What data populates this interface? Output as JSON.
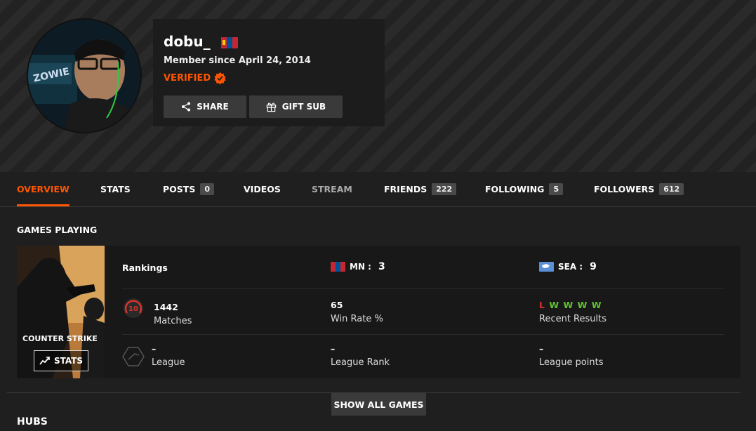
{
  "profile": {
    "username": "dobu_",
    "member_since": "Member since April 24, 2014",
    "verified_label": "VERIFIED",
    "share_label": "SHARE",
    "gift_sub_label": "GIFT SUB",
    "avatar_text": "ZOWIE"
  },
  "tabs": [
    {
      "label": "OVERVIEW"
    },
    {
      "label": "STATS"
    },
    {
      "label": "POSTS",
      "count": "0"
    },
    {
      "label": "VIDEOS"
    },
    {
      "label": "STREAM"
    },
    {
      "label": "FRIENDS",
      "count": "222"
    },
    {
      "label": "FOLLOWING",
      "count": "5"
    },
    {
      "label": "FOLLOWERS",
      "count": "612"
    }
  ],
  "games_section": {
    "title": "GAMES PLAYING",
    "cover_title": "COUNTER STRIKE",
    "stats_button": "STATS",
    "rankings_label": "Rankings",
    "country_rank": {
      "region": "MN :",
      "value": "3"
    },
    "region_rank": {
      "region": "SEA :",
      "value": "9"
    },
    "skill_level": "10",
    "matches": {
      "value": "1442",
      "label": "Matches"
    },
    "win_rate": {
      "value": "65",
      "label": "Win Rate %"
    },
    "recent_results": {
      "results": [
        "L",
        "W",
        "W",
        "W",
        "W"
      ],
      "label": "Recent Results"
    },
    "league": {
      "value": "–",
      "label": "League"
    },
    "league_rank": {
      "value": "–",
      "label": "League Rank"
    },
    "league_points": {
      "value": "–",
      "label": "League points"
    },
    "show_all": "SHOW ALL GAMES"
  },
  "hubs": {
    "title": "HUBS"
  },
  "colors": {
    "accent": "#ff5500",
    "win": "#5fc032",
    "loss": "#d9332b",
    "background": "#1f1f1f"
  }
}
